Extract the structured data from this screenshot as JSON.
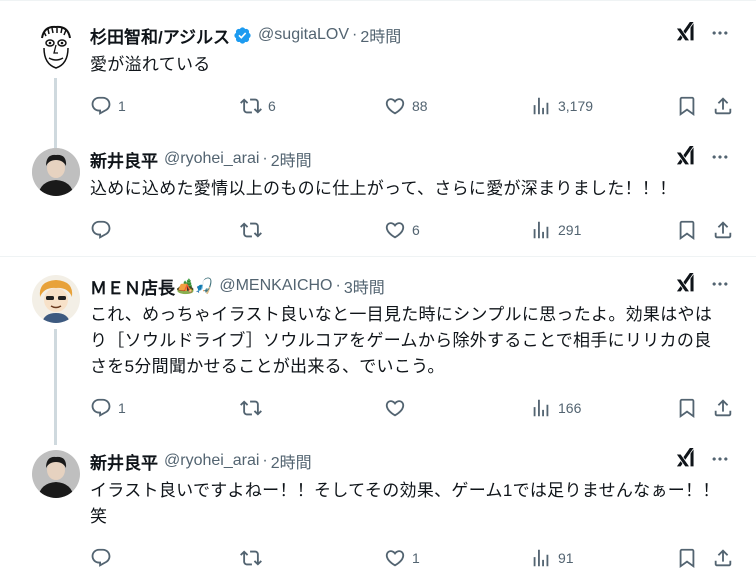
{
  "tweets": [
    {
      "name": "杉田智和/アジルス",
      "handle": "@sugitaLOV",
      "time": "2時間",
      "verified": true,
      "text": "愛が溢れている",
      "replies": "1",
      "retweets": "6",
      "likes": "88",
      "views": "3,179"
    },
    {
      "name": "新井良平",
      "handle": "@ryohei_arai",
      "time": "2時間",
      "text": "込めに込めた愛情以上のものに仕上がって、さらに愛が深まりました！！！",
      "replies": "",
      "retweets": "",
      "likes": "6",
      "views": "291"
    },
    {
      "name": "ＭＥＮ店長",
      "name_emoji": "🏕️🎣",
      "handle": "@MENKAICHO",
      "time": "3時間",
      "text": "これ、めっちゃイラスト良いなと一目見た時にシンプルに思ったよ。効果はやはり［ソウルドライブ］ソウルコアをゲームから除外することで相手にリリカの良さを5分間聞かせることが出来る、でいこう。",
      "replies": "1",
      "retweets": "",
      "likes": "",
      "views": "166"
    },
    {
      "name": "新井良平",
      "handle": "@ryohei_arai",
      "time": "2時間",
      "text": "イラスト良いですよねー！！そしてその効果、ゲーム1では足りませんなぁー！！笑",
      "replies": "",
      "retweets": "",
      "likes": "1",
      "views": "91"
    }
  ],
  "separator": "·",
  "colors": {
    "text": "#0f1419",
    "secondary": "#536471",
    "verified": "#1d9bf0",
    "divider": "#eff3f4",
    "thread_line": "#cfd9de"
  },
  "icons": {
    "reply": "reply-icon",
    "retweet": "retweet-icon",
    "like": "like-icon",
    "views": "views-icon",
    "bookmark": "bookmark-icon",
    "share": "share-icon",
    "grok": "grok-icon",
    "more": "more-icon"
  }
}
